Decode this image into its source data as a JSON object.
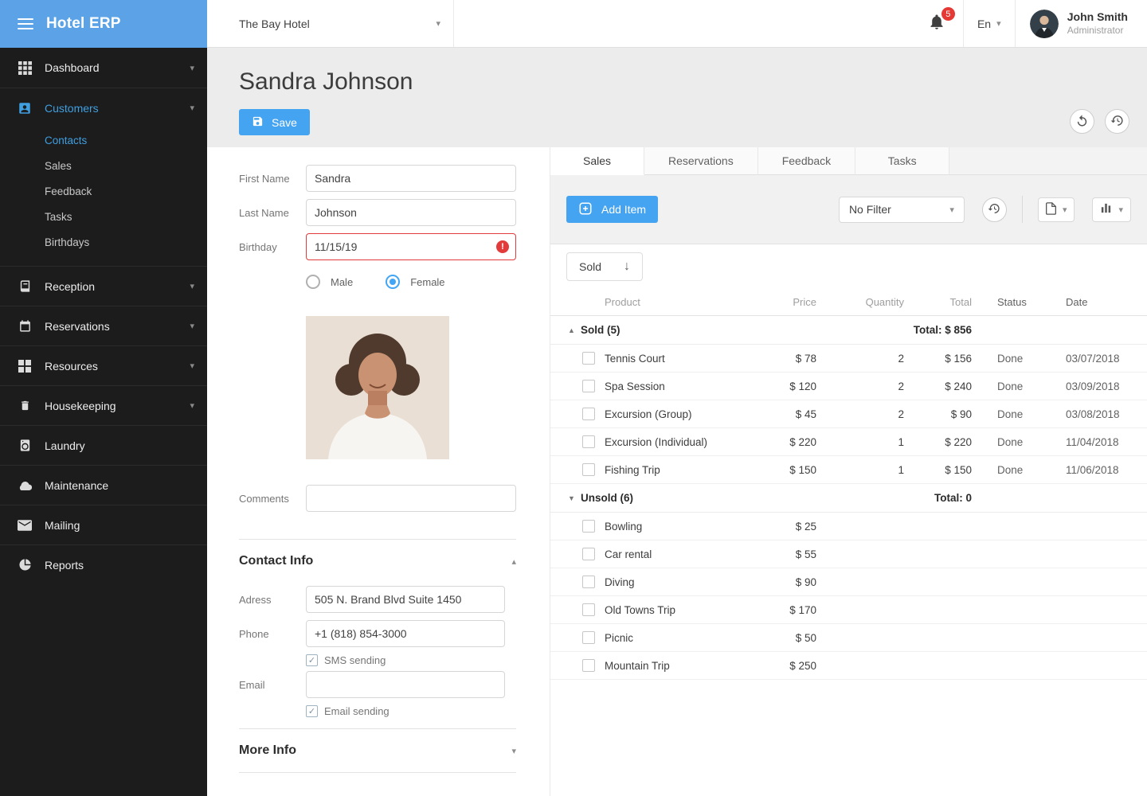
{
  "app": {
    "title": "Hotel ERP"
  },
  "colors": {
    "accent": "#45a4f1",
    "sidebar_header": "#5ba3e6",
    "active_link": "#3f9fe0",
    "error": "#e23b3b",
    "badge": "#e53935"
  },
  "header": {
    "hotel_selector": "The Bay Hotel",
    "notifications_count": "5",
    "language": "En",
    "user": {
      "name": "John Smith",
      "role": "Administrator"
    }
  },
  "sidebar": {
    "items": [
      {
        "label": "Dashboard",
        "icon": "dashboard",
        "expandable": true
      },
      {
        "label": "Customers",
        "icon": "customers",
        "expandable": true,
        "active": true,
        "sub": [
          {
            "label": "Contacts",
            "active": true
          },
          {
            "label": "Sales"
          },
          {
            "label": "Feedback"
          },
          {
            "label": "Tasks"
          },
          {
            "label": "Birthdays"
          }
        ]
      },
      {
        "label": "Reception",
        "icon": "reception",
        "expandable": true
      },
      {
        "label": "Reservations",
        "icon": "reservations",
        "expandable": true
      },
      {
        "label": "Resources",
        "icon": "resources",
        "expandable": true
      },
      {
        "label": "Housekeeping",
        "icon": "housekeeping",
        "expandable": true
      },
      {
        "label": "Laundry",
        "icon": "laundry"
      },
      {
        "label": "Maintenance",
        "icon": "maintenance"
      },
      {
        "label": "Mailing",
        "icon": "mailing"
      },
      {
        "label": "Reports",
        "icon": "reports"
      }
    ]
  },
  "page": {
    "title": "Sandra Johnson",
    "save_label": "Save"
  },
  "form": {
    "first_name": {
      "label": "First Name",
      "value": "Sandra"
    },
    "last_name": {
      "label": "Last Name",
      "value": "Johnson"
    },
    "birthday": {
      "label": "Birthday",
      "value": "11/15/19"
    },
    "gender": {
      "male": "Male",
      "female": "Female",
      "selected": "Female"
    },
    "comments": {
      "label": "Comments",
      "value": ""
    },
    "contact_info": {
      "title": "Contact Info",
      "address": {
        "label": "Adress",
        "value": "505 N. Brand Blvd Suite 1450"
      },
      "phone": {
        "label": "Phone",
        "value": "+1 (818) 854-3000"
      },
      "sms_label": "SMS sending",
      "sms_checked": true,
      "email": {
        "label": "Email",
        "value": ""
      },
      "email_sending_label": "Email sending",
      "email_checked": true
    },
    "more_info_title": "More Info"
  },
  "tabs": [
    {
      "label": "Sales",
      "active": true
    },
    {
      "label": "Reservations"
    },
    {
      "label": "Feedback"
    },
    {
      "label": "Tasks"
    }
  ],
  "sales_panel": {
    "add_item_label": "Add Item",
    "filter_value": "No Filter",
    "sort_label": "Sold",
    "columns": [
      "Product",
      "Price",
      "Quantity",
      "Total",
      "Status",
      "Date"
    ],
    "groups": [
      {
        "name": "Sold (5)",
        "total_label": "Total: $ 856",
        "caret": "up",
        "rows": [
          {
            "product": "Tennis Court",
            "price": "$ 78",
            "quantity": "2",
            "total": "$ 156",
            "status": "Done",
            "date": "03/07/2018"
          },
          {
            "product": "Spa Session",
            "price": "$ 120",
            "quantity": "2",
            "total": "$ 240",
            "status": "Done",
            "date": "03/09/2018"
          },
          {
            "product": "Excursion (Group)",
            "price": "$ 45",
            "quantity": "2",
            "total": "$ 90",
            "status": "Done",
            "date": "03/08/2018"
          },
          {
            "product": "Excursion (Individual)",
            "price": "$ 220",
            "quantity": "1",
            "total": "$ 220",
            "status": "Done",
            "date": "11/04/2018"
          },
          {
            "product": "Fishing Trip",
            "price": "$ 150",
            "quantity": "1",
            "total": "$ 150",
            "status": "Done",
            "date": "11/06/2018"
          }
        ]
      },
      {
        "name": "Unsold (6)",
        "total_label": "Total: 0",
        "caret": "down",
        "rows": [
          {
            "product": "Bowling",
            "price": "$ 25"
          },
          {
            "product": "Car rental",
            "price": "$ 55"
          },
          {
            "product": "Diving",
            "price": "$ 90"
          },
          {
            "product": "Old Towns Trip",
            "price": "$ 170"
          },
          {
            "product": "Picnic",
            "price": "$ 50"
          },
          {
            "product": "Mountain Trip",
            "price": "$ 250"
          }
        ]
      }
    ]
  }
}
